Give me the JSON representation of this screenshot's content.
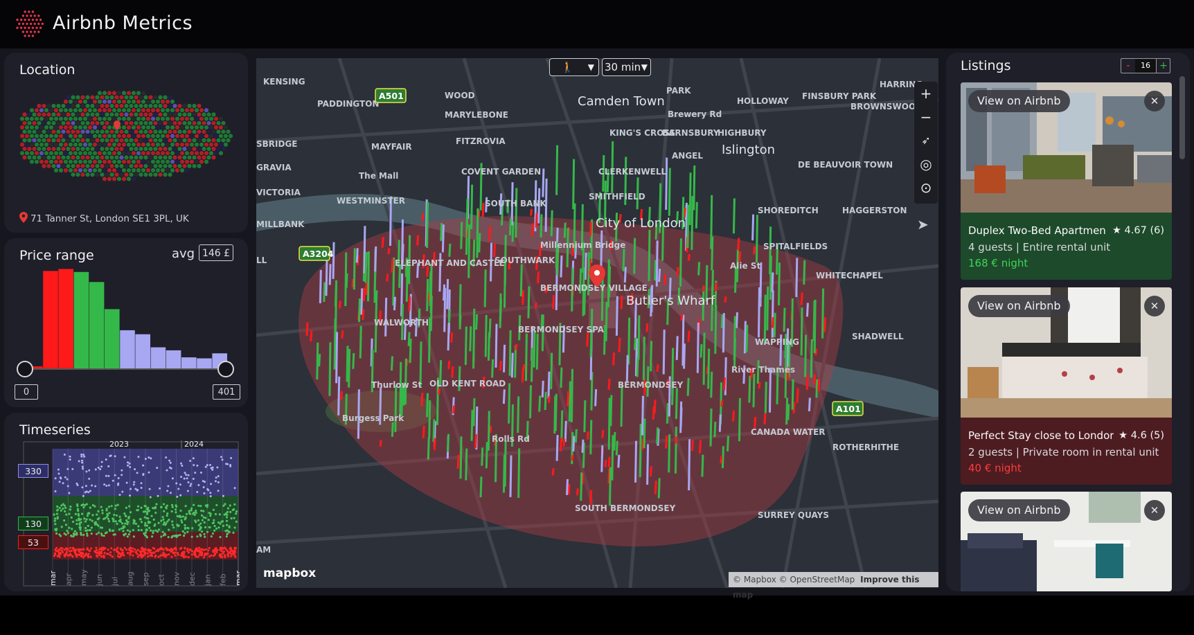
{
  "app": {
    "title": "Airbnb Metrics"
  },
  "location": {
    "title": "Location",
    "address": "71 Tanner St, London SE1 3PL, UK"
  },
  "price": {
    "title": "Price range",
    "avg_label": "avg",
    "avg_value": "146 £",
    "min": "0",
    "max": "401",
    "histogram": [
      0.02,
      0.97,
      0.99,
      0.96,
      0.86,
      0.59,
      0.38,
      0.34,
      0.21,
      0.18,
      0.11,
      0.1,
      0.15
    ],
    "histogram_colors": [
      "#ff1a1a",
      "#ff1a1a",
      "#ff1a1a",
      "#35b84a",
      "#35b84a",
      "#35b84a",
      "#a8a7f2",
      "#a8a7f2",
      "#a8a7f2",
      "#a8a7f2",
      "#a8a7f2",
      "#a8a7f2",
      "#a8a7f2"
    ]
  },
  "timeseries": {
    "title": "Timeseries",
    "years": [
      "2023",
      "2024"
    ],
    "thresholds": [
      "330",
      "130",
      "53"
    ],
    "months": [
      "mar",
      "apr",
      "may",
      "jun",
      "jul",
      "aug",
      "sep",
      "oct",
      "nov",
      "dec",
      "jan",
      "feb",
      "mar"
    ]
  },
  "map": {
    "mode": "walking",
    "time": "30 min",
    "labels": [
      "KENSING",
      "PADDINGTON",
      "WOOD",
      "Camden Town",
      "PARK",
      "HOLLOWAY",
      "FINSBURY PARK",
      "HARRING",
      "BROWNSWOOD",
      "MARYLEBONE",
      "Brewery Rd",
      "KING'S CROSS",
      "BARNSBURY",
      "HIGHBURY",
      "SBRIDGE",
      "MAYFAIR",
      "FITZROVIA",
      "Islington",
      "ANGEL",
      "DE BEAUVOIR TOWN",
      "GRAVIA",
      "The Mall",
      "COVENT GARDEN",
      "CLERKENWELL",
      "VICTORIA",
      "WESTMINSTER",
      "SMITHFIELD",
      "SOUTH BANK",
      "SHOREDITCH",
      "HAGGERSTON",
      "MILLBANK",
      "City of London",
      "Millennium Bridge",
      "SPITALFIELDS",
      "LL",
      "ELEPHANT AND CASTLE",
      "SOUTHWARK",
      "BERMONDSEY VILLAGE",
      "Butler's Wharf",
      "WHITECHAPEL",
      "WALWORTH",
      "BERMONDSEY SPA",
      "WAPPING",
      "SHADWELL",
      "Thurlow St",
      "OLD KENT ROAD",
      "River Thames",
      "BERMONDSEY",
      "Burgess Park",
      "Rolls Rd",
      "CANADA WATER",
      "ROTHERHITHE",
      "SOUTH BERMONDSEY",
      "SURREY QUAYS",
      "AM",
      "Alie St"
    ],
    "road_shields": [
      "A501",
      "A3204",
      "A101"
    ],
    "attribution": "© Mapbox © OpenStreetMap",
    "improve": "Improve this map",
    "brand": "mapbox"
  },
  "listings": {
    "title": "Listings",
    "count": "16",
    "minus": "-",
    "plus": "+",
    "items": [
      {
        "name": "Duplex Two-Bed Apartmen",
        "rating": "★ 4.67 (6)",
        "meta": "4 guests | Entire rental unit",
        "price": "168 € night",
        "bg": "#1d4a2a",
        "price_color": "#3fd45a",
        "view": "View on Airbnb",
        "close": "✕"
      },
      {
        "name": "Perfect Stay close to Londor",
        "rating": "★ 4.6 (5)",
        "meta": "2 guests | Private room in rental unit",
        "price": "40 € night",
        "bg": "#4d1c21",
        "price_color": "#ff3b3b",
        "view": "View on Airbnb",
        "close": "✕"
      },
      {
        "name": "",
        "rating": "",
        "meta": "",
        "price": "",
        "bg": "#1f1f29",
        "price_color": "#fff",
        "view": "View on Airbnb",
        "close": "✕"
      }
    ]
  },
  "colors": {
    "low": "#ff1a1a",
    "mid": "#35b84a",
    "high": "#a8a7f2",
    "panel": "#1f1f29",
    "background": "#16161e"
  }
}
